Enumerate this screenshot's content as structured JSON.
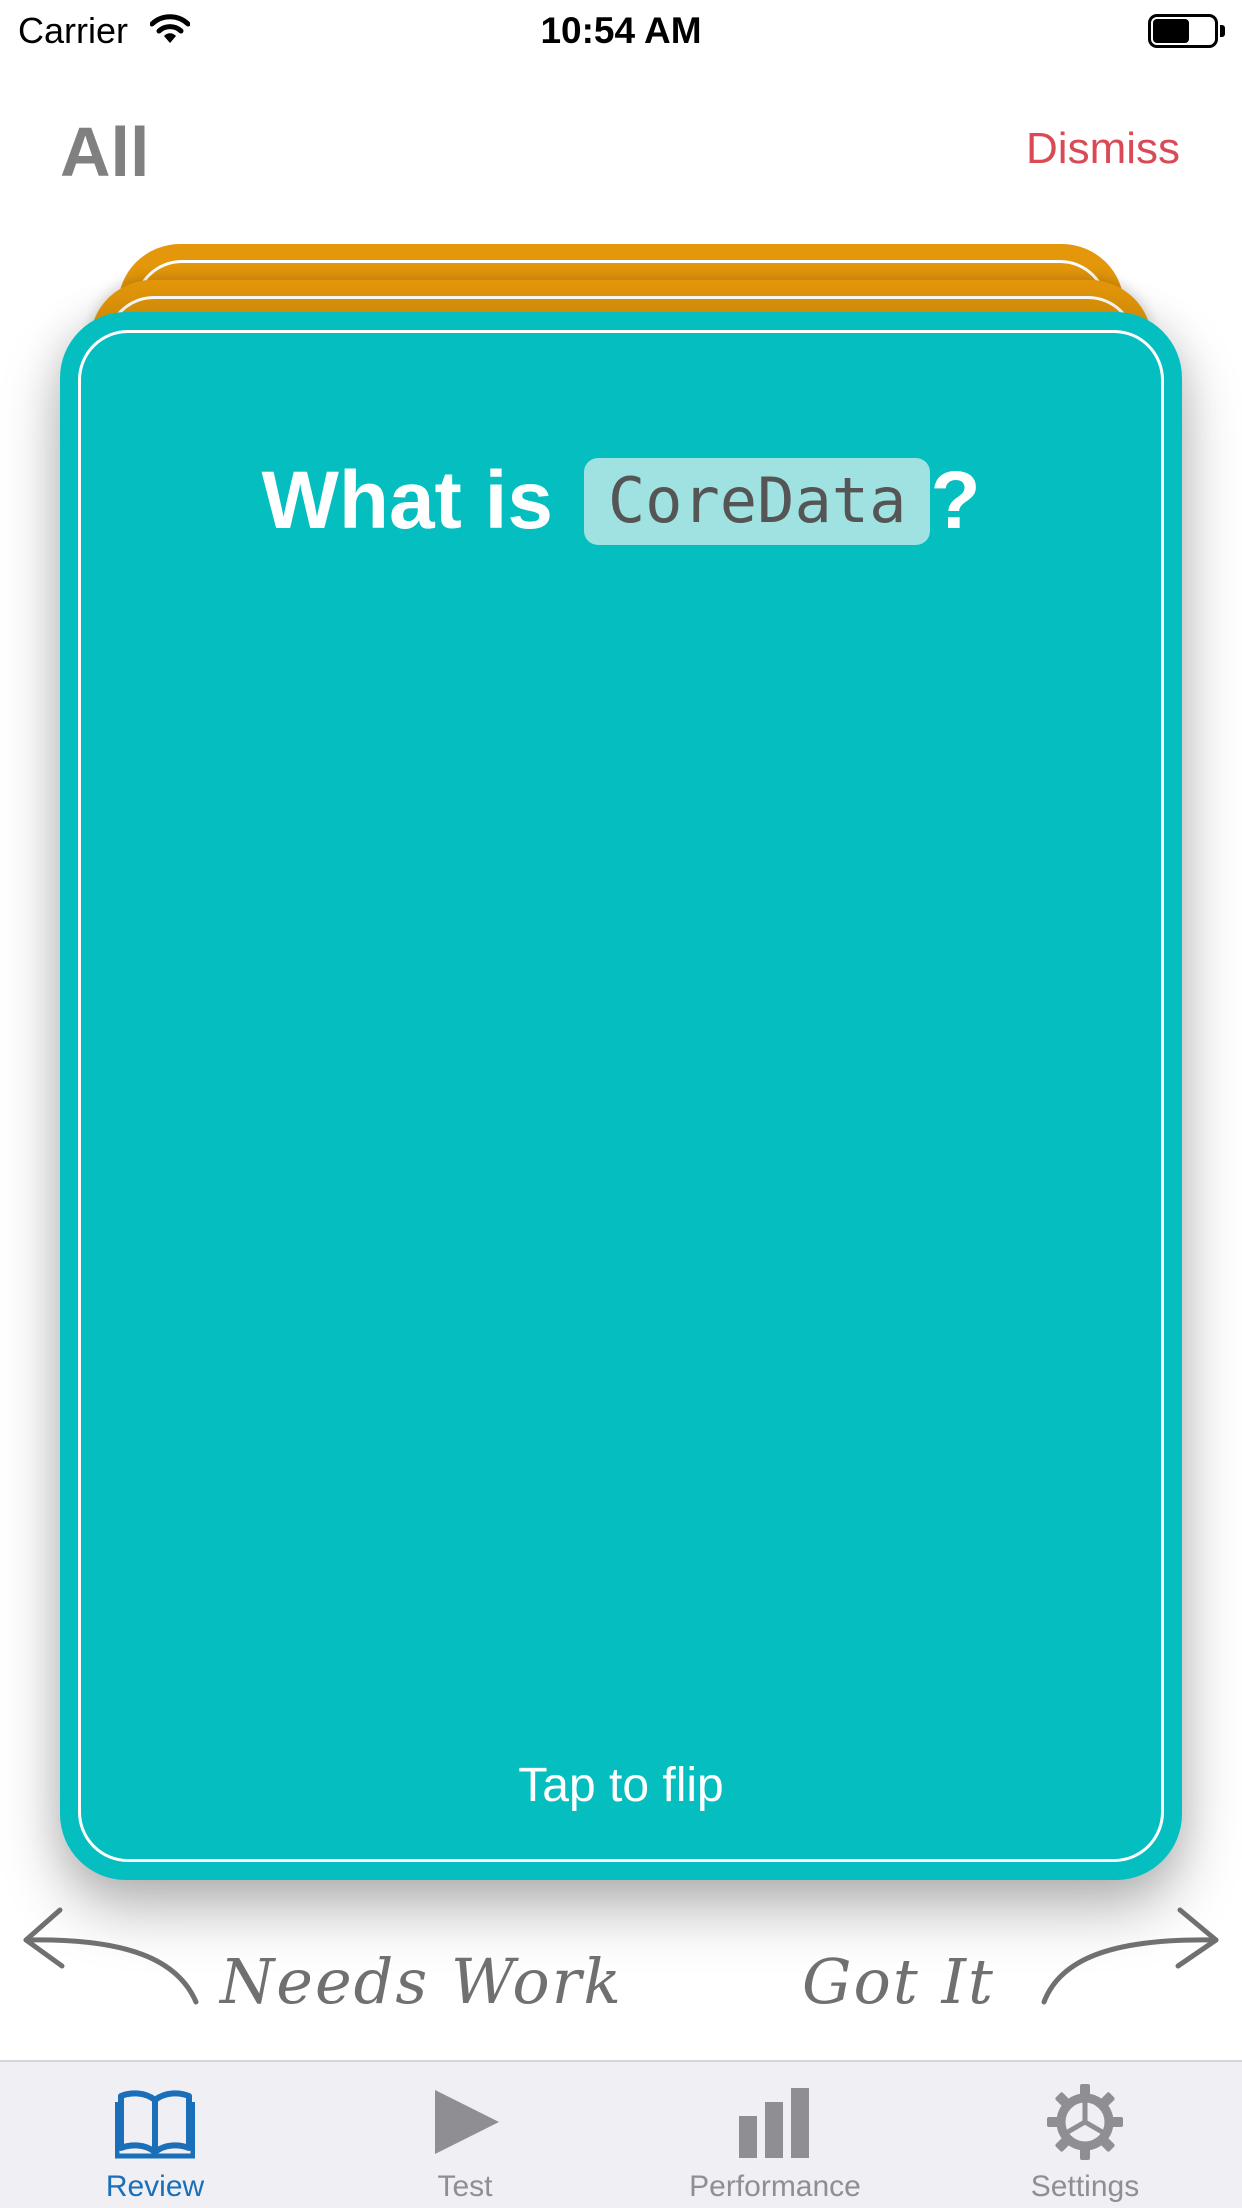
{
  "status_bar": {
    "carrier": "Carrier",
    "time": "10:54 AM"
  },
  "header": {
    "title": "All",
    "dismiss_label": "Dismiss",
    "dismiss_color": "#d94a56"
  },
  "card": {
    "question_prefix": "What is ",
    "question_code": "CoreData",
    "question_suffix": "?",
    "hint": "Tap to flip",
    "front_color": "#05bec0",
    "back_color": "#e4970a"
  },
  "swipe": {
    "left_label": "Needs Work",
    "right_label": "Got It"
  },
  "tabs": [
    {
      "label": "Review",
      "icon": "book-icon",
      "active": true
    },
    {
      "label": "Test",
      "icon": "play-icon",
      "active": false
    },
    {
      "label": "Performance",
      "icon": "bar-chart-icon",
      "active": false
    },
    {
      "label": "Settings",
      "icon": "gear-icon",
      "active": false
    }
  ],
  "colors": {
    "tab_active": "#1a6fb8",
    "tab_inactive": "#8e8e93"
  }
}
